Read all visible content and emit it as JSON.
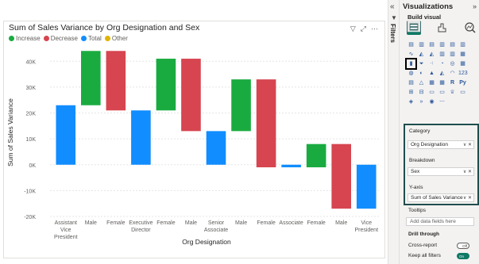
{
  "visual": {
    "title": "Sum of Sales Variance by Org Designation and Sex",
    "legend": [
      {
        "label": "Increase",
        "color": "#1aab40"
      },
      {
        "label": "Decrease",
        "color": "#d64550"
      },
      {
        "label": "Total",
        "color": "#118dff"
      },
      {
        "label": "Other",
        "color": "#e0b400"
      }
    ],
    "header_icons": [
      "filter-icon",
      "focus-mode-icon",
      "more-options-icon"
    ]
  },
  "chart_data": {
    "type": "bar",
    "subtype": "waterfall",
    "xlabel": "Org Designation",
    "ylabel": "Sum of Sales Variance",
    "ylim": [
      -20000,
      45000
    ],
    "yticks": [
      "-20K",
      "-10K",
      "0K",
      "10K",
      "20K",
      "30K",
      "40K"
    ],
    "ytick_values": [
      -20000,
      -10000,
      0,
      10000,
      20000,
      30000,
      40000
    ],
    "bars": [
      {
        "category": "Assistant Vice President",
        "kind": "Total",
        "start": 0,
        "end": 23000
      },
      {
        "category": "Male",
        "kind": "Increase",
        "start": 23000,
        "end": 44000
      },
      {
        "category": "Female",
        "kind": "Decrease",
        "start": 44000,
        "end": 21000
      },
      {
        "category": "Executive Director",
        "kind": "Total",
        "start": 0,
        "end": 21000
      },
      {
        "category": "Female",
        "kind": "Increase",
        "start": 21000,
        "end": 41000
      },
      {
        "category": "Male",
        "kind": "Decrease",
        "start": 41000,
        "end": 13000
      },
      {
        "category": "Senior Associate",
        "kind": "Total",
        "start": 0,
        "end": 13000
      },
      {
        "category": "Male",
        "kind": "Increase",
        "start": 13000,
        "end": 33000
      },
      {
        "category": "Female",
        "kind": "Decrease",
        "start": 33000,
        "end": -1000
      },
      {
        "category": "Associate",
        "kind": "Total",
        "start": 0,
        "end": -1000
      },
      {
        "category": "Female",
        "kind": "Increase",
        "start": -1000,
        "end": 8000
      },
      {
        "category": "Male",
        "kind": "Decrease",
        "start": 8000,
        "end": -17000
      },
      {
        "category": "Vice President",
        "kind": "Total",
        "start": 0,
        "end": -17000
      }
    ],
    "category_labels": [
      [
        "Assistant",
        "Vice",
        "President"
      ],
      [
        "Male"
      ],
      [
        "Female"
      ],
      [
        "Executive",
        "Director"
      ],
      [
        "Female"
      ],
      [
        "Male"
      ],
      [
        "Senior",
        "Associate"
      ],
      [
        "Male"
      ],
      [
        "Female"
      ],
      [
        "Associate"
      ],
      [
        "Female"
      ],
      [
        "Male"
      ],
      [
        "Vice",
        "President"
      ]
    ],
    "colors": {
      "Increase": "#1aab40",
      "Decrease": "#d64550",
      "Total": "#118dff"
    },
    "grid": true,
    "legend_position": "top-left"
  },
  "filters_pane": {
    "label": "Filters",
    "collapse_icon": "chevron-left-icon"
  },
  "viz_pane": {
    "title": "Visualizations",
    "build_label": "Build visual",
    "header_icons": [
      "chevron-left-icon",
      "chevron-right-icon"
    ],
    "wells": {
      "category_label": "Category",
      "category_value": "Org Designation",
      "breakdown_label": "Breakdown",
      "breakdown_value": "Sex",
      "yaxis_label": "Y-axis",
      "yaxis_value": "Sum of Sales Variance"
    },
    "tooltips_label": "Tooltips",
    "tooltips_placeholder": "Add data fields here",
    "drill_through_label": "Drill through",
    "cross_report_label": "Cross-report",
    "cross_report_state": "Off",
    "keep_filters_label": "Keep all filters",
    "keep_filters_state": "On"
  }
}
